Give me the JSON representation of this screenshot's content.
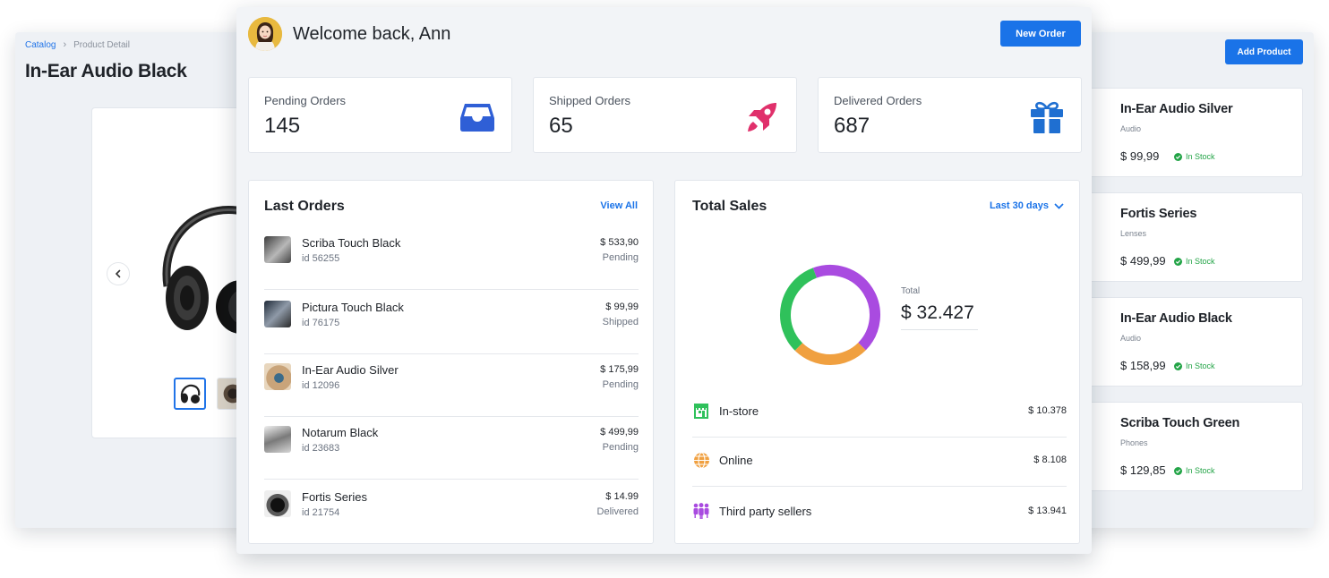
{
  "product_detail": {
    "breadcrumb": [
      "Catalog",
      "Product Detail"
    ],
    "title": "In-Ear Audio Black",
    "prev_icon": "chevron-left-icon"
  },
  "catalog": {
    "add_product_label": "Add Product",
    "products": [
      {
        "name": "In-Ear Audio Silver",
        "category": "Audio",
        "price": "$ 99,99",
        "stock": "In Stock"
      },
      {
        "name": "Fortis Series",
        "category": "Lenses",
        "price": "$ 499,99",
        "stock": "In Stock"
      },
      {
        "name": "In-Ear Audio Black",
        "category": "Audio",
        "price": "$ 158,99",
        "stock": "In Stock"
      },
      {
        "name": "Scriba Touch Green",
        "category": "Phones",
        "price": "$ 129,85",
        "stock": "In Stock"
      }
    ],
    "stock_color": "#23a447"
  },
  "header": {
    "welcome": "Welcome back, Ann",
    "new_order_label": "New Order"
  },
  "stats": [
    {
      "label": "Pending Orders",
      "value": "145",
      "icon": "inbox-icon",
      "color": "#2f5fd6"
    },
    {
      "label": "Shipped Orders",
      "value": "65",
      "icon": "rocket-icon",
      "color": "#e0306b"
    },
    {
      "label": "Delivered Orders",
      "value": "687",
      "icon": "gift-icon",
      "color": "#1f6fd1"
    }
  ],
  "last_orders": {
    "title": "Last Orders",
    "view_all": "View All",
    "orders": [
      {
        "name": "Scriba Touch Black",
        "id": "id 56255",
        "amount": "$ 533,90",
        "status": "Pending"
      },
      {
        "name": "Pictura Touch Black",
        "id": "id 76175",
        "amount": "$ 99,99",
        "status": "Shipped"
      },
      {
        "name": "In-Ear Audio Silver",
        "id": "id 12096",
        "amount": "$ 175,99",
        "status": "Pending"
      },
      {
        "name": "Notarum Black",
        "id": "id 23683",
        "amount": "$ 499,99",
        "status": "Pending"
      },
      {
        "name": "Fortis Series",
        "id": "id 21754",
        "amount": "$ 14.99",
        "status": "Delivered"
      }
    ]
  },
  "total_sales": {
    "title": "Total Sales",
    "range": "Last 30 days",
    "total_label": "Total",
    "total_value": "$ 32.427",
    "channels": [
      {
        "name": "In-store",
        "amount": "$ 10.378",
        "icon": "store-icon",
        "color": "#2fc15b"
      },
      {
        "name": "Online",
        "amount": "$ 8.108",
        "icon": "globe-icon",
        "color": "#f0a040"
      },
      {
        "name": "Third party sellers",
        "amount": "$ 13.941",
        "icon": "people-icon",
        "color": "#a94be0"
      }
    ],
    "donut_values": [
      10.378,
      8.108,
      13.941
    ]
  },
  "colors": {
    "accent": "#1a73e8"
  }
}
